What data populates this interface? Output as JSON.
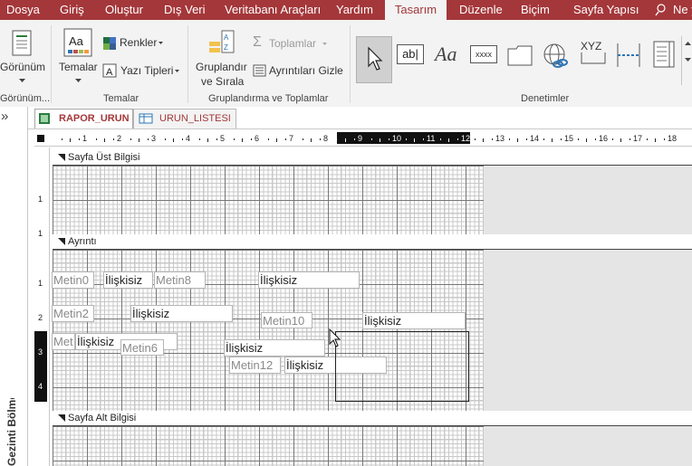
{
  "menu": {
    "tabs": [
      "Dosya",
      "Giriş",
      "Oluştur",
      "Dış Veri",
      "Veritabanı Araçları",
      "Yardım",
      "Tasarım",
      "Düzenle",
      "Biçim",
      "Sayfa Yapısı"
    ],
    "tell_me": "Ne y",
    "active": "Tasarım"
  },
  "ribbon": {
    "views": {
      "button": "Görünüm",
      "group": "Görünüm..."
    },
    "themes": {
      "button": "Temalar",
      "colors": "Renkler",
      "fonts": "Yazı Tipleri",
      "group": "Temalar"
    },
    "grouping": {
      "button_line1": "Gruplandır",
      "button_line2": "ve Sırala",
      "totals": "Toplamlar",
      "hide_details": "Ayrıntıları Gizle",
      "group": "Gruplandırma ve Toplamlar"
    },
    "controls": {
      "group": "Denetimler",
      "label_text": "Aa",
      "textbox_text": "ab|",
      "xyz_text": "XYZ",
      "xxxx_text": "xxxx"
    }
  },
  "nav_pane": {
    "collapse": "»",
    "title": "Gezinti Bölmesi"
  },
  "doc_tabs": [
    {
      "label": "RAPOR_URUN",
      "active": true
    },
    {
      "label": "URUN_LISTESI",
      "active": false
    }
  ],
  "ruler": {
    "marks": [
      "1",
      "2",
      "3",
      "4",
      "5",
      "6",
      "7",
      "8",
      "9",
      "10",
      "11",
      "12",
      "13",
      "14",
      "15",
      "16",
      "17",
      "18"
    ]
  },
  "vruler": {
    "header": [
      "1",
      "1"
    ],
    "detail": [
      "1",
      "2",
      "3",
      "4"
    ]
  },
  "sections": {
    "page_header": "Sayfa Üst Bilgisi",
    "detail": "Ayrıntı",
    "page_footer": "Sayfa Alt Bilgisi"
  },
  "controls": {
    "metin0": "Metin0",
    "iliskisiz_1": "İlişkisiz",
    "metin8": "Metin8",
    "iliskisiz_2": "İlişkisiz",
    "metin2": "Metin2",
    "iliskisiz_3": "İlişkisiz",
    "metin10": "Metin10",
    "iliskisiz_4": "İlişkisiz",
    "met": "Met",
    "iliskisiz_5": "İlişkisiz",
    "metin6": "Metin6",
    "iliskisiz_6": "İlişkisiz",
    "metin12": "Metin12",
    "iliskisiz_7": "İlişkisiz"
  },
  "colors": {
    "accent": "#a4373a",
    "ribbon_bg": "#f3f3f3",
    "canvas_gray": "#e5e5e5"
  }
}
